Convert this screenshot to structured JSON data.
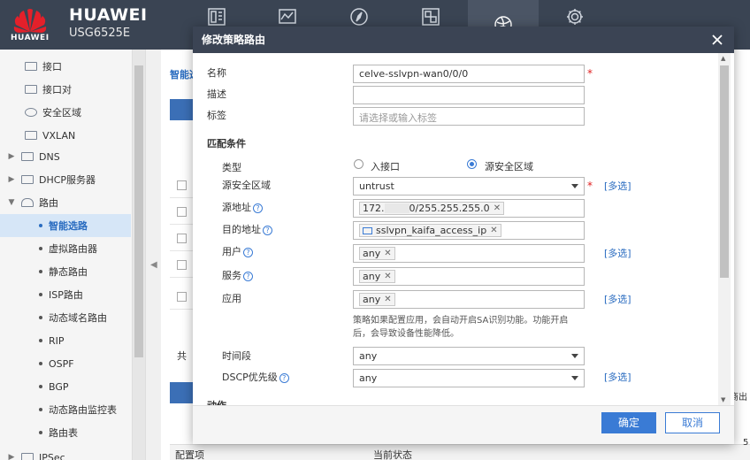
{
  "header": {
    "logo_text": "HUAWEI",
    "brand": "HUAWEI",
    "model": "USG6525E",
    "nav_icons": [
      "dashboard-icon",
      "monitor-icon",
      "policy-icon",
      "object-icon",
      "network-icon",
      "system-icon"
    ]
  },
  "sidebar": {
    "items": [
      {
        "label": "接口",
        "type": "leaf"
      },
      {
        "label": "接口对",
        "type": "leaf"
      },
      {
        "label": "安全区域",
        "type": "leaf"
      },
      {
        "label": "VXLAN",
        "type": "leaf"
      },
      {
        "label": "DNS",
        "type": "group"
      },
      {
        "label": "DHCP服务器",
        "type": "group"
      },
      {
        "label": "路由",
        "type": "group-open"
      },
      {
        "label": "智能选路",
        "type": "sub",
        "active": true
      },
      {
        "label": "虚拟路由器",
        "type": "sub"
      },
      {
        "label": "静态路由",
        "type": "sub"
      },
      {
        "label": "ISP路由",
        "type": "sub"
      },
      {
        "label": "动态域名路由",
        "type": "sub"
      },
      {
        "label": "RIP",
        "type": "sub"
      },
      {
        "label": "OSPF",
        "type": "sub"
      },
      {
        "label": "BGP",
        "type": "sub"
      },
      {
        "label": "动态路由监控表",
        "type": "sub"
      },
      {
        "label": "路由表",
        "type": "sub"
      },
      {
        "label": "IPSec",
        "type": "group"
      }
    ]
  },
  "background": {
    "tab_label": "智能选",
    "footer_label": "共",
    "bottom_col1": "配置项",
    "bottom_col2": "当前状态",
    "right_label": "商出",
    "right_num": "5"
  },
  "modal": {
    "title": "修改策略路由",
    "labels": {
      "name": "名称",
      "desc": "描述",
      "tag": "标签",
      "match_section": "匹配条件",
      "type": "类型",
      "src_zone": "源安全区域",
      "src_addr": "源地址",
      "dst_addr": "目的地址",
      "user": "用户",
      "service": "服务",
      "app": "应用",
      "time": "时间段",
      "dscp": "DSCP优先级",
      "action_section": "动作"
    },
    "name_value": "celve-sslvpn-wan0/0/0",
    "desc_value": "",
    "tag_placeholder": "请选择或输入标签",
    "type_options": [
      "入接口",
      "源安全区域"
    ],
    "type_selected": "源安全区域",
    "src_zone_value": "untrust",
    "src_addr_prefix": "172.",
    "src_addr_suffix": "0/255.255.255.0",
    "dst_addr_value": "sslvpn_kaifa_access_ip",
    "user_value": "any",
    "service_value": "any",
    "app_value": "any",
    "app_note_line1": "策略如果配置应用，会自动开启SA识别功能。功能开启",
    "app_note_line2": "后，会导致设备性能降低。",
    "time_value": "any",
    "dscp_value": "any",
    "multi_select": "[多选]",
    "required_mark": "*",
    "ok_label": "确定",
    "cancel_label": "取消"
  }
}
